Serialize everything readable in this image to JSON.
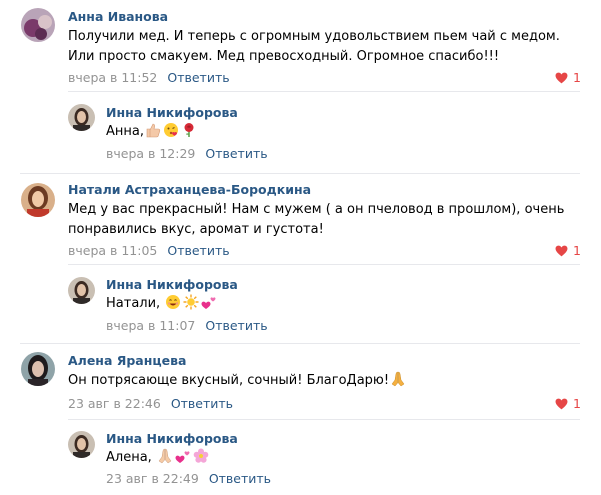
{
  "comments": [
    {
      "author": "Анна Иванова",
      "lines": [
        "Получили мед. И теперь с огромным удовольствием пьем чай с медом.",
        "Или просто смакуем. Мед превосходный. Огромное спасибо!!!"
      ],
      "date": "вчера в 11:52",
      "reply_label": "Ответить",
      "likes": "1"
    },
    {
      "author": "Инна Никифорова",
      "text": "Анна,",
      "emoji": [
        "thumbs-up-icon",
        "kiss-face-icon",
        "rose-icon"
      ],
      "date": "вчера в 12:29",
      "reply_label": "Ответить"
    },
    {
      "author": "Натали Астраханцева-Бородкина",
      "lines": [
        "Мед у вас прекрасный! Нам с мужем ( а он пчеловод в прошлом), очень",
        "понравились вкус, аромат и густота!"
      ],
      "date": "вчера в 11:05",
      "reply_label": "Ответить",
      "likes": "1"
    },
    {
      "author": "Инна Никифорова",
      "text": "Натали,",
      "emoji": [
        "smile-face-icon",
        "sun-icon",
        "hearts-icon"
      ],
      "date": "вчера в 11:07",
      "reply_label": "Ответить"
    },
    {
      "author": "Алена Яранцева",
      "text": "Он потрясающе вкусный, сочный! БлагоДарю!",
      "emoji": [
        "praying-hands-icon"
      ],
      "date": "23 авг в 22:46",
      "reply_label": "Ответить",
      "likes": "1"
    },
    {
      "author": "Инна Никифорова",
      "text": "Алена,",
      "emoji": [
        "praying-hands-icon",
        "hearts-icon",
        "blossom-icon"
      ],
      "date": "23 авг в 22:49",
      "reply_label": "Ответить"
    }
  ],
  "colors": {
    "link": "#2a5885",
    "meta": "#939393",
    "like": "#e64646",
    "separator": "#e7e8ec"
  }
}
